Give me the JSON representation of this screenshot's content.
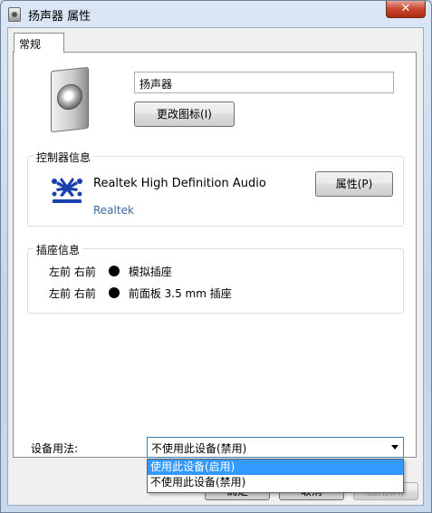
{
  "window": {
    "title": "扬声器 属性",
    "close_label": "✕"
  },
  "tabs": [
    {
      "label": "常规"
    }
  ],
  "general": {
    "device_name": "扬声器",
    "change_icon_label": "更改图标(I)"
  },
  "controller": {
    "legend": "控制器信息",
    "name": "Realtek High Definition Audio",
    "vendor": "Realtek",
    "properties_label": "属性(P)"
  },
  "jacks": {
    "legend": "插座信息",
    "rows": [
      {
        "channels": "左前 右前",
        "color": "#000000",
        "type": "模拟插座"
      },
      {
        "channels": "左前 右前",
        "color": "#000000",
        "type": "前面板 3.5 mm 插座"
      }
    ]
  },
  "usage": {
    "label": "设备用法:",
    "selected": "不使用此设备(禁用)",
    "options": [
      "使用此设备(启用)",
      "不使用此设备(禁用)"
    ],
    "highlighted_index": 0
  },
  "footer": {
    "ok_label": "确定",
    "cancel_label": "取消",
    "apply_label": "应用(A)"
  },
  "colors": {
    "accent": "#3399ff",
    "vendor_link": "#3c6a9f"
  }
}
